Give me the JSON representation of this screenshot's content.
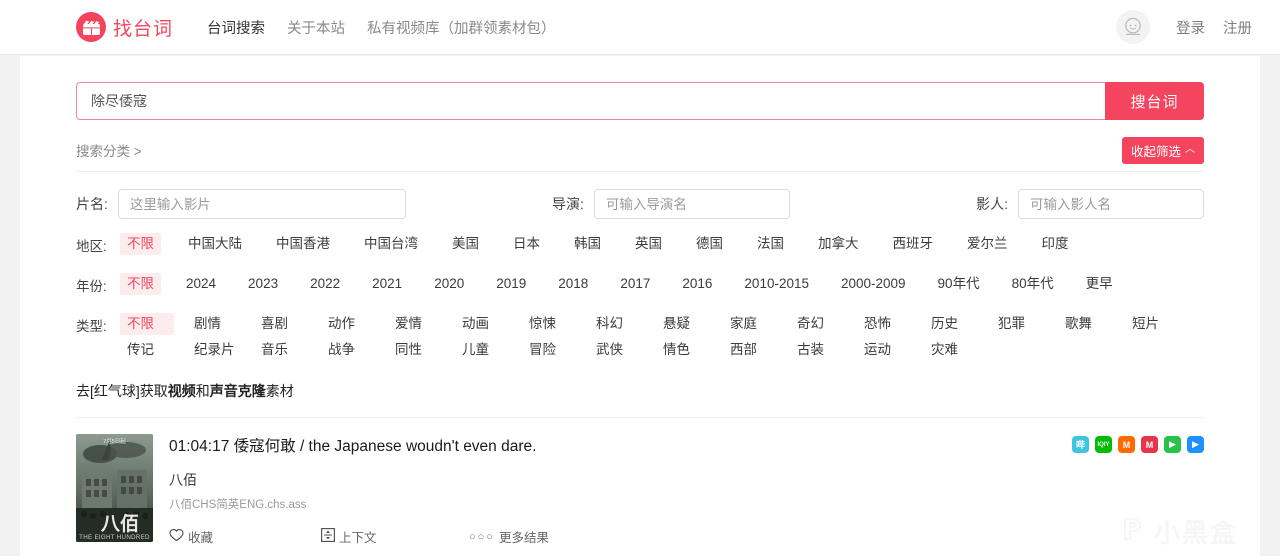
{
  "header": {
    "brand_name": "找台词",
    "brand_icon": "clapperboard-icon",
    "nav": [
      {
        "label": "台词搜索",
        "active": true
      },
      {
        "label": "关于本站",
        "active": false
      },
      {
        "label": "私有视频库（加群领素材包）",
        "active": false
      }
    ],
    "avatar_icon": "user-avatar-icon",
    "login_label": "登录",
    "register_label": "注册"
  },
  "search": {
    "value": "除尽倭寇",
    "placeholder": "",
    "button_label": "搜台词"
  },
  "filters": {
    "category_label": "搜索分类 >",
    "collapse_label": "收起筛选",
    "collapse_caret": "︿",
    "text_fields": [
      {
        "label": "片名:",
        "placeholder": "这里输入影片",
        "value": ""
      },
      {
        "label": "导演:",
        "placeholder": "可输入导演名",
        "value": ""
      },
      {
        "label": "影人:",
        "placeholder": "可输入影人名",
        "value": ""
      }
    ],
    "region": {
      "label": "地区:",
      "options": [
        "不限",
        "中国大陆",
        "中国香港",
        "中国台湾",
        "美国",
        "日本",
        "韩国",
        "英国",
        "德国",
        "法国",
        "加拿大",
        "西班牙",
        "爱尔兰",
        "印度"
      ],
      "selected": "不限"
    },
    "year": {
      "label": "年份:",
      "options": [
        "不限",
        "2024",
        "2023",
        "2022",
        "2021",
        "2020",
        "2019",
        "2018",
        "2017",
        "2016",
        "2010-2015",
        "2000-2009",
        "90年代",
        "80年代",
        "更早"
      ],
      "selected": "不限"
    },
    "genre": {
      "label": "类型:",
      "options": [
        "不限",
        "剧情",
        "喜剧",
        "动作",
        "爱情",
        "动画",
        "惊悚",
        "科幻",
        "悬疑",
        "家庭",
        "奇幻",
        "恐怖",
        "历史",
        "犯罪",
        "歌舞",
        "短片",
        "传记",
        "纪录片",
        "音乐",
        "战争",
        "同性",
        "儿童",
        "冒险",
        "武侠",
        "情色",
        "西部",
        "古装",
        "运动",
        "灾难"
      ],
      "selected": "不限"
    }
  },
  "promo": {
    "prefix": "去[红气球]获取",
    "bold1": "视频",
    "middle": "和",
    "bold2": "声音克隆",
    "suffix": "素材"
  },
  "results": [
    {
      "timestamp": "01:04:17",
      "line_cn": "倭寇何敢",
      "line_en": "/ the Japanese woudn't even dare.",
      "title_full": "01:04:17 倭寇何敢 / the Japanese woudn't even dare.",
      "movie": "八佰",
      "subtitle_file": "八佰CHS简英ENG.chs.ass",
      "poster_title": "八佰",
      "poster_en": "THE EIGHT HUNDRED",
      "poster_date": "7月5日起",
      "favorite_label": "收藏",
      "context_label": "上下文",
      "more_label": "更多结果",
      "platforms": [
        {
          "name": "bilibili-icon",
          "glyph": "哔",
          "color": "#3ec6e0"
        },
        {
          "name": "iqiyi-icon",
          "glyph": "IQIY",
          "color": "#00be06"
        },
        {
          "name": "mangotv-icon",
          "glyph": "M",
          "color": "#ff6a00"
        },
        {
          "name": "migu-icon",
          "glyph": "M",
          "color": "#e8334a"
        },
        {
          "name": "youku-icon",
          "glyph": "▶",
          "color": "#2bc24a"
        },
        {
          "name": "tencent-video-icon",
          "glyph": "▶",
          "color": "#1e90ff"
        }
      ]
    }
  ],
  "watermark": {
    "text": "小黑盒",
    "icon": "xiaoheihe-logo-icon"
  },
  "colors": {
    "accent": "#f5455e",
    "page_bg": "#f2f2f2",
    "panel_bg": "#ffffff"
  }
}
